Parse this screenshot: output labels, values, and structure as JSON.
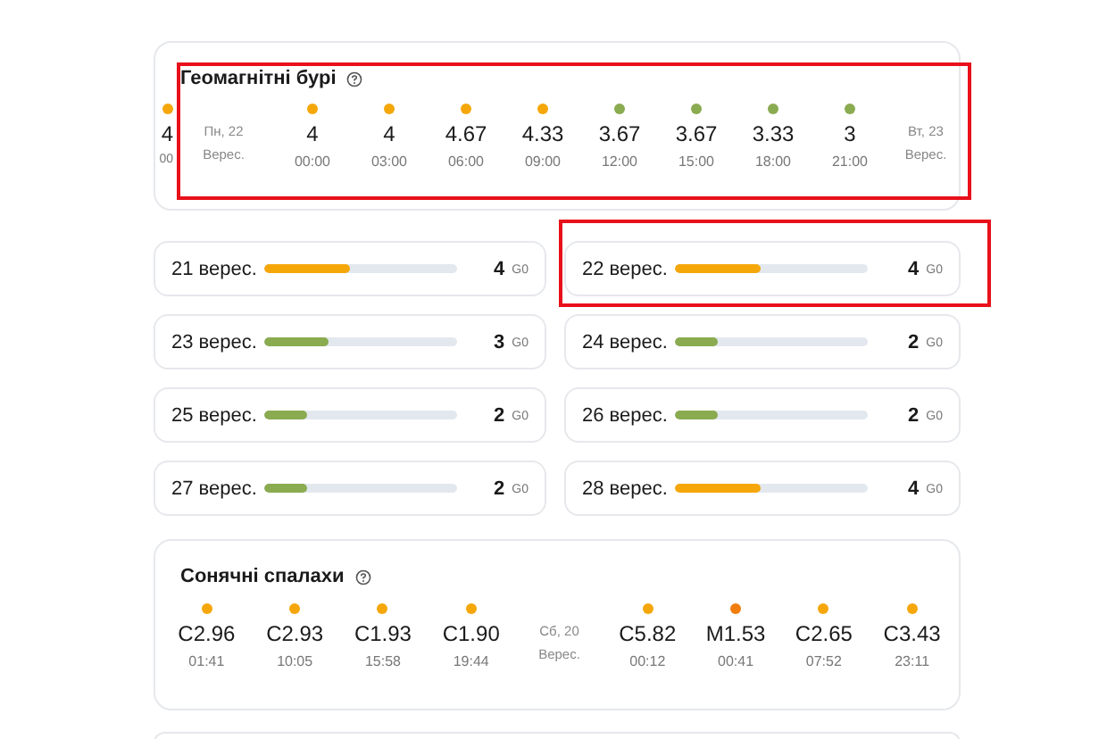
{
  "geomagnetic_storms": {
    "title": "Геомагнітні бурі",
    "highlighted": true,
    "items": [
      {
        "kind": "reading",
        "value": "4",
        "time": "00",
        "color": "#f5a70a"
      },
      {
        "kind": "day",
        "label": "Пн, 22",
        "sublabel": "Верес."
      },
      {
        "kind": "reading",
        "value": "4",
        "time": "00:00",
        "color": "#f5a70a"
      },
      {
        "kind": "reading",
        "value": "4",
        "time": "03:00",
        "color": "#f5a70a"
      },
      {
        "kind": "reading",
        "value": "4.67",
        "time": "06:00",
        "color": "#f5a70a"
      },
      {
        "kind": "reading",
        "value": "4.33",
        "time": "09:00",
        "color": "#f5a70a"
      },
      {
        "kind": "reading",
        "value": "3.67",
        "time": "12:00",
        "color": "#8aab50"
      },
      {
        "kind": "reading",
        "value": "3.67",
        "time": "15:00",
        "color": "#8aab50"
      },
      {
        "kind": "reading",
        "value": "3.33",
        "time": "18:00",
        "color": "#8aab50"
      },
      {
        "kind": "reading",
        "value": "3",
        "time": "21:00",
        "color": "#8aab50"
      },
      {
        "kind": "day",
        "label": "Вт, 23",
        "sublabel": "Верес."
      }
    ]
  },
  "daily_forecast": [
    {
      "date": "21 верес.",
      "level": 0.44,
      "value": "4",
      "unit": "G0",
      "color": "#f5a70a",
      "highlighted": false
    },
    {
      "date": "22 верес.",
      "level": 0.44,
      "value": "4",
      "unit": "G0",
      "color": "#f5a70a",
      "highlighted": true
    },
    {
      "date": "23 верес.",
      "level": 0.33,
      "value": "3",
      "unit": "G0",
      "color": "#8aab50",
      "highlighted": false
    },
    {
      "date": "24 верес.",
      "level": 0.22,
      "value": "2",
      "unit": "G0",
      "color": "#8aab50",
      "highlighted": false
    },
    {
      "date": "25 верес.",
      "level": 0.22,
      "value": "2",
      "unit": "G0",
      "color": "#8aab50",
      "highlighted": false
    },
    {
      "date": "26 верес.",
      "level": 0.22,
      "value": "2",
      "unit": "G0",
      "color": "#8aab50",
      "highlighted": false
    },
    {
      "date": "27 верес.",
      "level": 0.22,
      "value": "2",
      "unit": "G0",
      "color": "#8aab50",
      "highlighted": false
    },
    {
      "date": "28 верес.",
      "level": 0.44,
      "value": "4",
      "unit": "G0",
      "color": "#f5a70a",
      "highlighted": false
    }
  ],
  "solar_flares": {
    "title": "Сонячні спалахи",
    "items": [
      {
        "kind": "reading",
        "value": "C2.96",
        "time": "01:41",
        "color": "#f5a70a"
      },
      {
        "kind": "reading",
        "value": "C2.93",
        "time": "10:05",
        "color": "#f5a70a"
      },
      {
        "kind": "reading",
        "value": "C1.93",
        "time": "15:58",
        "color": "#f5a70a"
      },
      {
        "kind": "reading",
        "value": "C1.90",
        "time": "19:44",
        "color": "#f5a70a"
      },
      {
        "kind": "day",
        "label": "Сб, 20",
        "sublabel": "Верес."
      },
      {
        "kind": "reading",
        "value": "C5.82",
        "time": "00:12",
        "color": "#f5a70a"
      },
      {
        "kind": "reading",
        "value": "M1.53",
        "time": "00:41",
        "color": "#f07d0e"
      },
      {
        "kind": "reading",
        "value": "C2.65",
        "time": "07:52",
        "color": "#f5a70a"
      },
      {
        "kind": "reading",
        "value": "C3.43",
        "time": "23:11",
        "color": "#f5a70a"
      }
    ]
  }
}
